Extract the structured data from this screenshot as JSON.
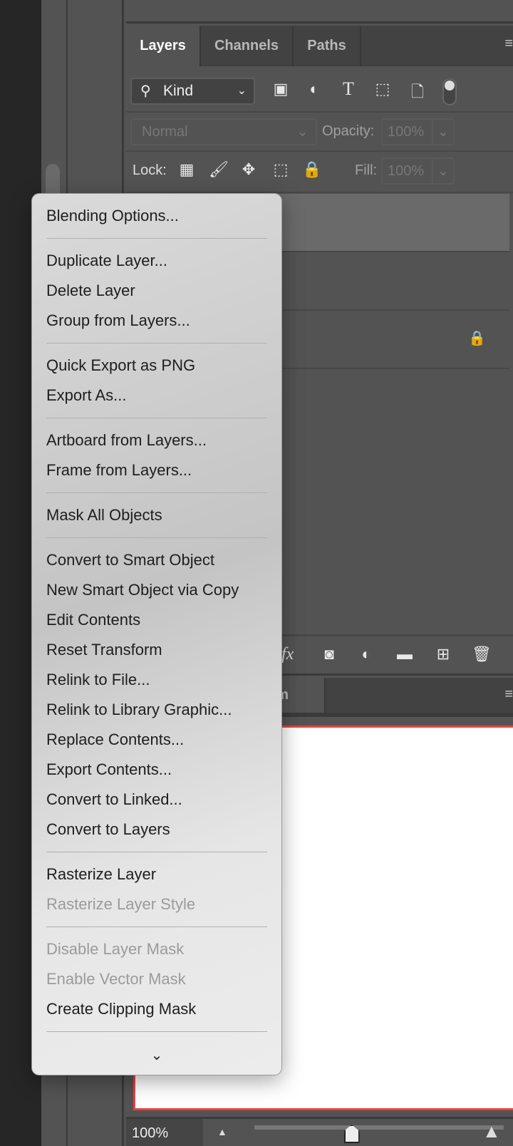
{
  "tabs": [
    {
      "label": "Layers",
      "active": true
    },
    {
      "label": "Channels"
    },
    {
      "label": "Paths"
    }
  ],
  "filter": {
    "kind_label": "Kind",
    "icons": [
      "image-filter-icon",
      "adjustment-filter-icon",
      "type-filter-icon",
      "shape-filter-icon",
      "smart-object-filter-icon"
    ]
  },
  "blend": {
    "mode": "Normal",
    "opacity_label": "Opacity:",
    "opacity_value": "100%"
  },
  "lock": {
    "label": "Lock:",
    "fill_label": "Fill:",
    "fill_value": "100%"
  },
  "bottom_panel": {
    "tab_partial": "ram"
  },
  "status": {
    "zoom": "100%",
    "zoom_slider_fraction": 0.39
  },
  "menu": {
    "groups": [
      [
        {
          "label": "Blending Options..."
        }
      ],
      [
        {
          "label": "Duplicate Layer..."
        },
        {
          "label": "Delete Layer"
        },
        {
          "label": "Group from Layers..."
        }
      ],
      [
        {
          "label": "Quick Export as PNG"
        },
        {
          "label": "Export As..."
        }
      ],
      [
        {
          "label": "Artboard from Layers..."
        },
        {
          "label": "Frame from Layers..."
        }
      ],
      [
        {
          "label": "Mask All Objects"
        }
      ],
      [
        {
          "label": "Convert to Smart Object"
        },
        {
          "label": "New Smart Object via Copy"
        },
        {
          "label": "Edit Contents"
        },
        {
          "label": "Reset Transform"
        },
        {
          "label": "Relink to File..."
        },
        {
          "label": "Relink to Library Graphic..."
        },
        {
          "label": "Replace Contents..."
        },
        {
          "label": "Export Contents..."
        },
        {
          "label": "Convert to Linked..."
        },
        {
          "label": "Convert to Layers"
        }
      ],
      [
        {
          "label": "Rasterize Layer"
        },
        {
          "label": "Rasterize Layer Style",
          "disabled": true
        }
      ],
      [
        {
          "label": "Disable Layer Mask",
          "disabled": true
        },
        {
          "label": "Enable Vector Mask",
          "disabled": true
        },
        {
          "label": "Create Clipping Mask"
        }
      ]
    ]
  }
}
